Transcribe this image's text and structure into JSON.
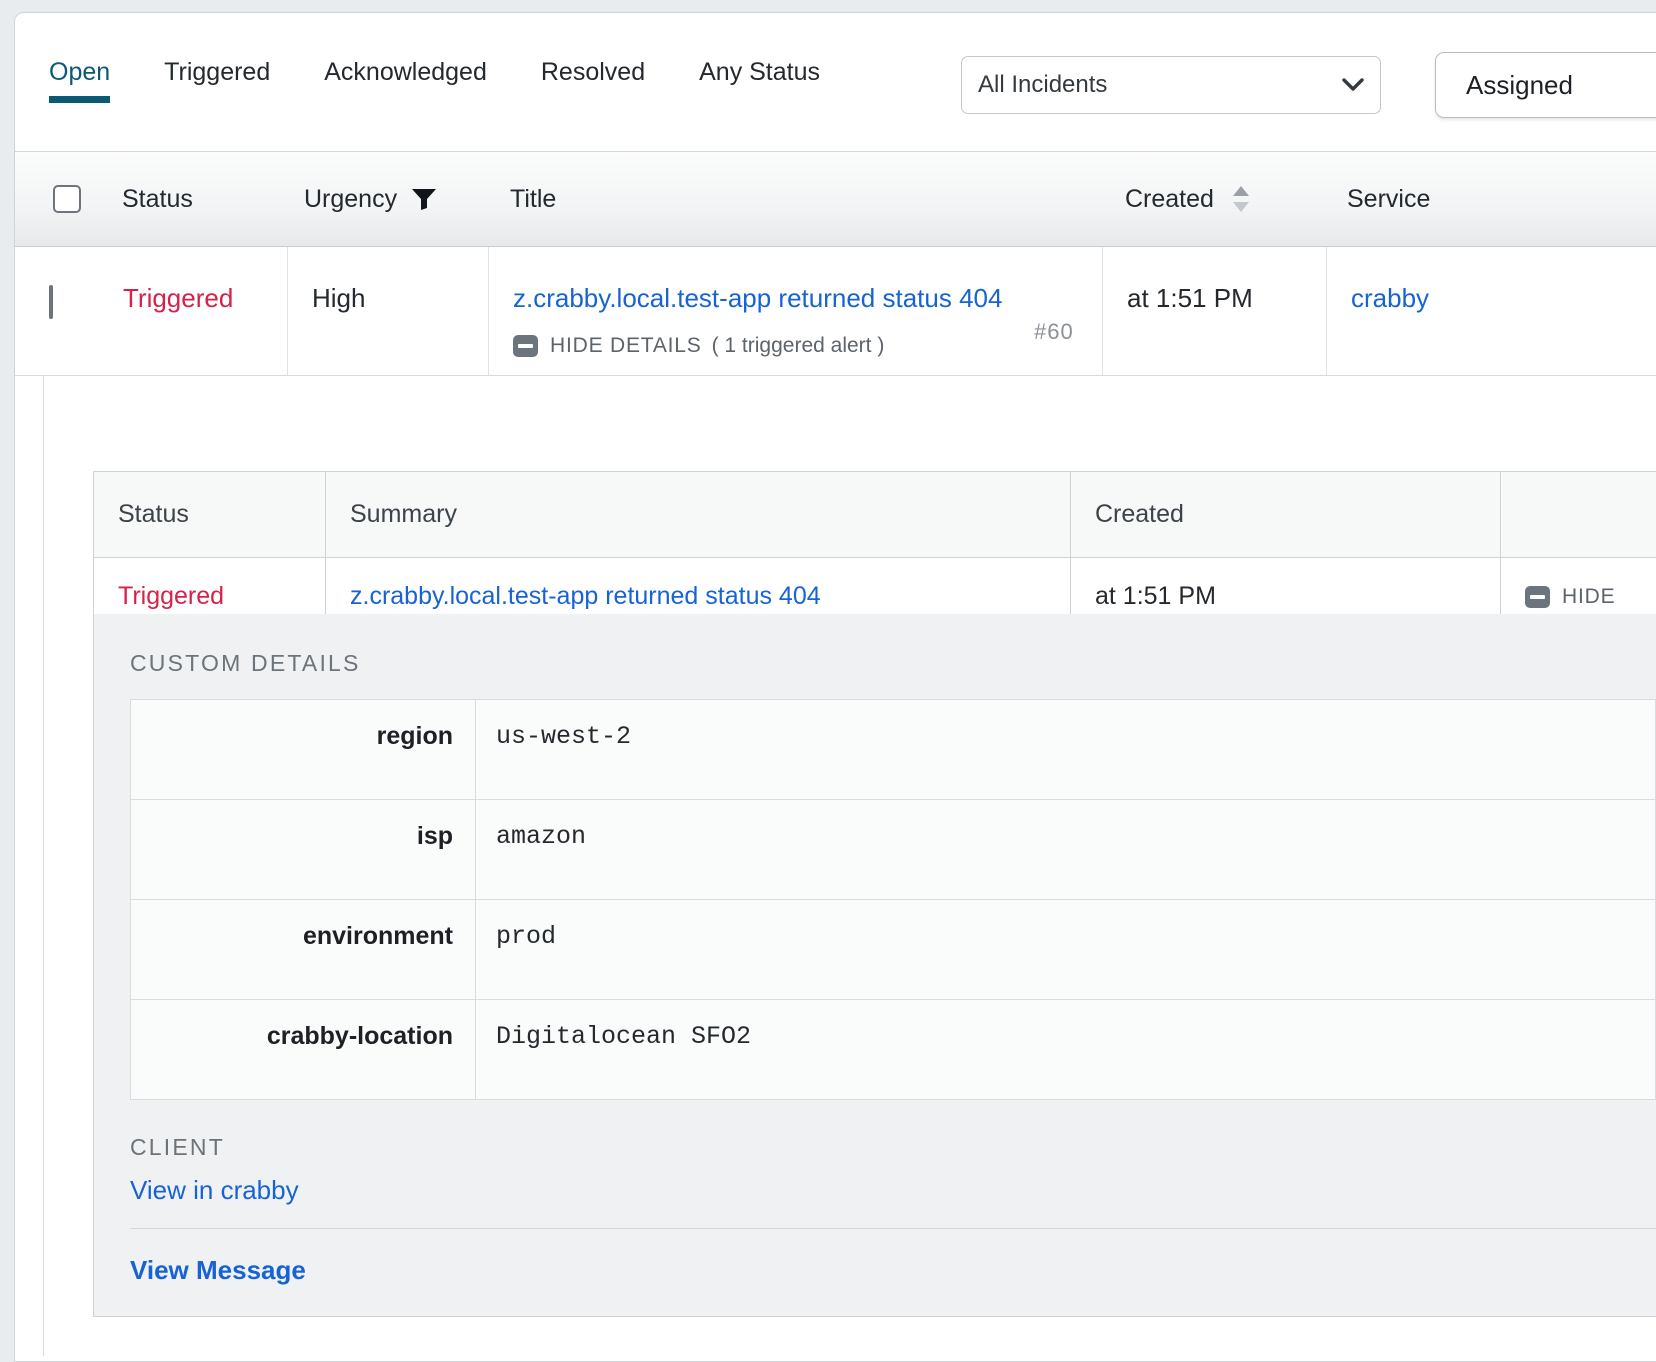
{
  "toolbar": {
    "tabs": [
      {
        "label": "Open",
        "active": true
      },
      {
        "label": "Triggered",
        "active": false
      },
      {
        "label": "Acknowledged",
        "active": false
      },
      {
        "label": "Resolved",
        "active": false
      },
      {
        "label": "Any Status",
        "active": false
      }
    ],
    "incident_filter": {
      "selected": "All Incidents",
      "options": [
        "All Incidents"
      ]
    },
    "assigned_button": "Assigned"
  },
  "table": {
    "headers": {
      "select_all": "",
      "status": "Status",
      "urgency": "Urgency",
      "title": "Title",
      "created": "Created",
      "service": "Service"
    },
    "rows": [
      {
        "status": "Triggered",
        "urgency": "High",
        "title": "z.crabby.local.test-app returned status 404",
        "toggle_label": "HIDE DETAILS",
        "alert_count": "( 1 triggered alert )",
        "incident_number": "#60",
        "created": "at 1:51 PM",
        "service": "crabby"
      }
    ]
  },
  "detail": {
    "alerts_table": {
      "headers": {
        "status": "Status",
        "summary": "Summary",
        "created": "Created",
        "actions": ""
      },
      "rows": [
        {
          "status": "Triggered",
          "summary": "z.crabby.local.test-app returned status 404",
          "created": "at 1:51 PM",
          "toggle_label": "HIDE"
        }
      ]
    },
    "custom_details": {
      "heading": "CUSTOM DETAILS",
      "entries": [
        {
          "key": "region",
          "value": "us-west-2"
        },
        {
          "key": "isp",
          "value": "amazon"
        },
        {
          "key": "environment",
          "value": "prod"
        },
        {
          "key": "crabby-location",
          "value": "Digitalocean SFO2"
        }
      ]
    },
    "client": {
      "heading": "CLIENT",
      "link_label": "View in crabby"
    },
    "view_message_label": "View Message"
  },
  "colors": {
    "accent_tab": "#0A5A73",
    "link": "#1763D6",
    "status_triggered": "#D6224A",
    "header_text": "#24292E",
    "muted_text": "#6C737A",
    "panel_bg": "#F0F1F2"
  },
  "icons": {
    "checkbox": "checkbox-icon",
    "filter": "filter-icon",
    "sort": "sort-icon",
    "chevron_down": "chevron-down-icon",
    "collapse_minus": "minus-square-icon"
  }
}
